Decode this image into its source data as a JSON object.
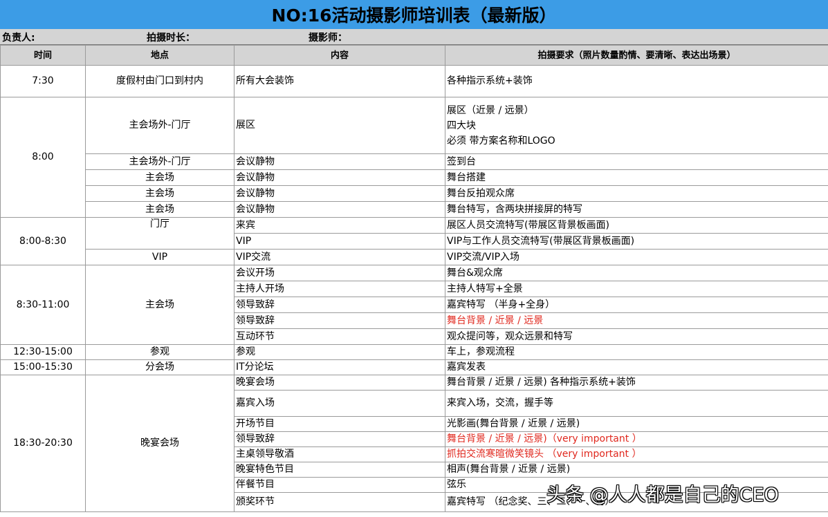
{
  "title": "NO:16活动摄影师培训表（最新版）",
  "meta": {
    "owner_label": "负责人:",
    "duration_label": "拍摄时长：",
    "photographer_label": "摄影师："
  },
  "headers": [
    "时间",
    "地点",
    "内容",
    "拍摄要求（照片数量酌情、要清晰、表达出场景）"
  ],
  "rows": {
    "r1": {
      "time": "7:30",
      "place": "度假村由门口到村内",
      "content": "所有大会装饰",
      "req": "各种指示系统+装饰"
    },
    "r2": {
      "time": "8:00",
      "place": "主会场外-门厅",
      "content": "展区",
      "req1": "展区（近景 / 远景）",
      "req2": "四大块",
      "req3": "必须 带方案名称和LOGO"
    },
    "r3": {
      "place": "主会场外-门厅",
      "content": "会议静物",
      "req": "签到台"
    },
    "r4": {
      "place": "主会场",
      "content": "会议静物",
      "req": "舞台搭建"
    },
    "r5": {
      "place": "主会场",
      "content": "会议静物",
      "req": "舞台反拍观众席"
    },
    "r6": {
      "place": "主会场",
      "content": "会议静物",
      "req": "舞台特写，含两块拼接屏的特写"
    },
    "r7": {
      "time": "8:00-8:30",
      "place": "门厅",
      "content": "来宾",
      "req": "展区人员交流特写(带展区背景板画面)"
    },
    "r8": {
      "content": "VIP",
      "req": "VIP与工作人员交流特写(带展区背景板画面)"
    },
    "r9": {
      "place": "VIP",
      "content": "VIP交流",
      "req": "VIP交流/VIP入场"
    },
    "r10": {
      "time": "8:30-11:00",
      "place": "主会场",
      "content": "会议开场",
      "req": "舞台&观众席"
    },
    "r11": {
      "content": "主持人开场",
      "req": "主持人特写+全景"
    },
    "r12": {
      "content": "领导致辞",
      "req": "嘉宾特写 （半身+全身）"
    },
    "r13": {
      "content": "领导致辞",
      "req": "舞台背景 / 近景 / 远景"
    },
    "r14": {
      "content": "互动环节",
      "req": "观众提问等，观众远景和特写"
    },
    "r15": {
      "time": "12:30-15:00",
      "place": "参观",
      "content": "参观",
      "req": "车上，参观流程"
    },
    "r16": {
      "time": "15:00-15:30",
      "place": "分会场",
      "content": "IT分论坛",
      "req": "嘉宾发表"
    },
    "r17": {
      "time": "18:30-20:30",
      "place": "晚宴会场",
      "content": "晚宴会场",
      "req": "舞台背景 / 近景 / 远景) 各种指示系统+装饰"
    },
    "r18": {
      "content": "嘉宾入场",
      "req": "来宾入场，交流，握手等"
    },
    "r19": {
      "content": "开场节目",
      "req": "光影画(舞台背景 / 近景 / 远景)"
    },
    "r20": {
      "content": "领导致辞",
      "req": "舞台背景 / 近景 / 远景)（very important ）"
    },
    "r21": {
      "content": "主桌领导敬酒",
      "req": "抓拍交流寒暄微笑镜头 （very important ）"
    },
    "r22": {
      "content": "晚宴特色节目",
      "req": "相声(舞台背景 / 近景 / 远景)"
    },
    "r23": {
      "content": "伴餐节目",
      "req": "弦乐"
    },
    "r24": {
      "content": "颁奖环节",
      "req": "嘉宾特写 （纪念奖、三、二、一、特）"
    }
  },
  "watermark": "头条 @人人都是自己的CEO",
  "colors": {
    "title_bg": "#3c9ce6",
    "header_bg": "#d4d4d4",
    "alert_text": "#e0281e"
  }
}
